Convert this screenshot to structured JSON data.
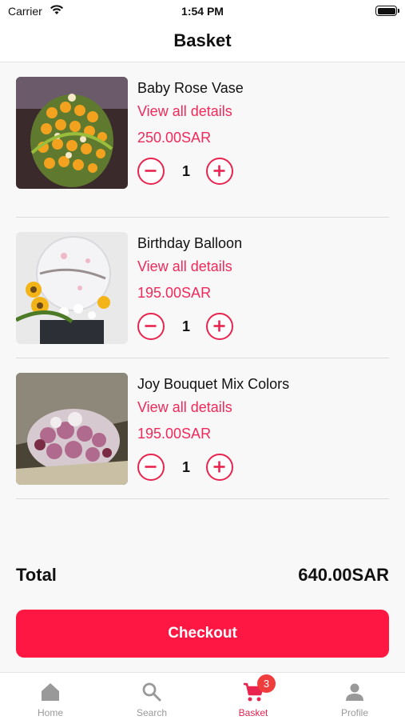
{
  "status_bar": {
    "carrier": "Carrier",
    "time": "1:54 PM"
  },
  "header": {
    "title": "Basket"
  },
  "items": [
    {
      "name": "Baby Rose Vase",
      "link": "View all details",
      "price": "250.00SAR",
      "qty": "1",
      "image_icon": "flower-vase-photo"
    },
    {
      "name": "Birthday Balloon",
      "link": "View all details",
      "price": "195.00SAR",
      "qty": "1",
      "image_icon": "balloon-bouquet-photo"
    },
    {
      "name": "Joy Bouquet Mix Colors",
      "link": "View all details",
      "price": "195.00SAR",
      "qty": "1",
      "image_icon": "mixed-bouquet-photo"
    }
  ],
  "summary": {
    "total_label": "Total",
    "total_value": "640.00SAR"
  },
  "checkout": {
    "label": "Checkout"
  },
  "tabs": [
    {
      "label": "Home",
      "icon": "home-icon",
      "active": false
    },
    {
      "label": "Search",
      "icon": "search-icon",
      "active": false
    },
    {
      "label": "Basket",
      "icon": "cart-icon",
      "active": true,
      "badge": "3"
    },
    {
      "label": "Profile",
      "icon": "person-icon",
      "active": false
    }
  ],
  "colors": {
    "accent": "#ef2a5a",
    "checkout": "#ff1744",
    "badge": "#ef3d3d",
    "inactive_tab": "#999999"
  }
}
